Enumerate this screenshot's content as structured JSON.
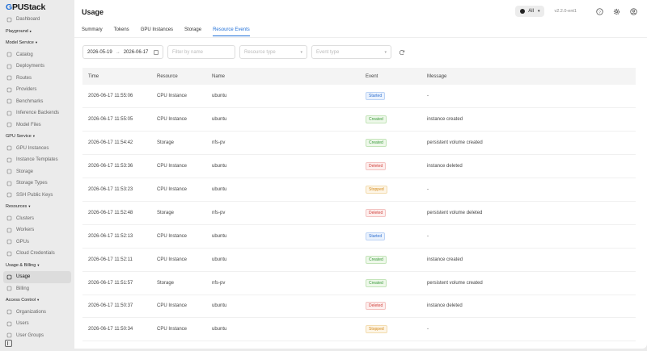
{
  "app": {
    "logo_g": "G",
    "logo_rest": "PUStack"
  },
  "sidebar": {
    "items": [
      {
        "type": "item",
        "label": "Dashboard",
        "icon": "dashboard-icon"
      },
      {
        "type": "section",
        "label": "Playground",
        "caret": "▸"
      },
      {
        "type": "section",
        "label": "Model Service",
        "caret": "▾"
      },
      {
        "type": "item",
        "label": "Catalog",
        "icon": "catalog-icon"
      },
      {
        "type": "item",
        "label": "Deployments",
        "icon": "deployments-icon"
      },
      {
        "type": "item",
        "label": "Routes",
        "icon": "routes-icon"
      },
      {
        "type": "item",
        "label": "Providers",
        "icon": "providers-icon"
      },
      {
        "type": "item",
        "label": "Benchmarks",
        "icon": "benchmarks-icon"
      },
      {
        "type": "item",
        "label": "Inference Backends",
        "icon": "backends-icon"
      },
      {
        "type": "item",
        "label": "Model Files",
        "icon": "files-icon"
      },
      {
        "type": "section",
        "label": "GPU Service",
        "caret": "▾"
      },
      {
        "type": "item",
        "label": "GPU Instances",
        "icon": "gpu-instances-icon"
      },
      {
        "type": "item",
        "label": "Instance Templates",
        "icon": "templates-icon"
      },
      {
        "type": "item",
        "label": "Storage",
        "icon": "storage-icon"
      },
      {
        "type": "item",
        "label": "Storage Types",
        "icon": "storage-types-icon"
      },
      {
        "type": "item",
        "label": "SSH Public Keys",
        "icon": "key-icon"
      },
      {
        "type": "section",
        "label": "Resources",
        "caret": "▾"
      },
      {
        "type": "item",
        "label": "Clusters",
        "icon": "clusters-icon"
      },
      {
        "type": "item",
        "label": "Workers",
        "icon": "workers-icon"
      },
      {
        "type": "item",
        "label": "GPUs",
        "icon": "gpus-icon"
      },
      {
        "type": "item",
        "label": "Cloud Credentials",
        "icon": "cloud-icon"
      },
      {
        "type": "section",
        "label": "Usage & Billing",
        "caret": "▾"
      },
      {
        "type": "item",
        "label": "Usage",
        "icon": "usage-icon",
        "active": true
      },
      {
        "type": "item",
        "label": "Billing",
        "icon": "billing-icon"
      },
      {
        "type": "section",
        "label": "Access Control",
        "caret": "▾"
      },
      {
        "type": "item",
        "label": "Organizations",
        "icon": "organizations-icon"
      },
      {
        "type": "item",
        "label": "Users",
        "icon": "users-icon"
      },
      {
        "type": "item",
        "label": "User Groups",
        "icon": "user-groups-icon"
      }
    ]
  },
  "header": {
    "title": "Usage",
    "scope_select": "All",
    "version": "v2.2.0-ent1"
  },
  "tabs": [
    {
      "label": "Summary",
      "active": false
    },
    {
      "label": "Tokens",
      "active": false
    },
    {
      "label": "GPU Instances",
      "active": false
    },
    {
      "label": "Storage",
      "active": false
    },
    {
      "label": "Resource Events",
      "active": true
    }
  ],
  "filters": {
    "date_start": "2026-05-19",
    "date_end": "2026-06-17",
    "name_placeholder": "Filter by name",
    "resource_type_placeholder": "Resource type",
    "event_type_placeholder": "Event type"
  },
  "table": {
    "columns": [
      "Time",
      "Resource",
      "Name",
      "Event",
      "Message"
    ],
    "rows": [
      {
        "time": "2026-06-17 11:55:06",
        "resource": "CPU Instance",
        "name": "ubuntu",
        "event": "Started",
        "message": "-"
      },
      {
        "time": "2026-06-17 11:55:05",
        "resource": "CPU Instance",
        "name": "ubuntu",
        "event": "Created",
        "message": "instance created"
      },
      {
        "time": "2026-06-17 11:54:42",
        "resource": "Storage",
        "name": "nfs-pv",
        "event": "Created",
        "message": "persistent volume created"
      },
      {
        "time": "2026-06-17 11:53:36",
        "resource": "CPU Instance",
        "name": "ubuntu",
        "event": "Deleted",
        "message": "instance deleted"
      },
      {
        "time": "2026-06-17 11:53:23",
        "resource": "CPU Instance",
        "name": "ubuntu",
        "event": "Stopped",
        "message": "-"
      },
      {
        "time": "2026-06-17 11:52:48",
        "resource": "Storage",
        "name": "nfs-pv",
        "event": "Deleted",
        "message": "persistent volume deleted"
      },
      {
        "time": "2026-06-17 11:52:13",
        "resource": "CPU Instance",
        "name": "ubuntu",
        "event": "Started",
        "message": "-"
      },
      {
        "time": "2026-06-17 11:52:11",
        "resource": "CPU Instance",
        "name": "ubuntu",
        "event": "Created",
        "message": "instance created"
      },
      {
        "time": "2026-06-17 11:51:57",
        "resource": "Storage",
        "name": "nfs-pv",
        "event": "Created",
        "message": "persistent volume created"
      },
      {
        "time": "2026-06-17 11:50:37",
        "resource": "CPU Instance",
        "name": "ubuntu",
        "event": "Deleted",
        "message": "instance deleted"
      },
      {
        "time": "2026-06-17 11:50:34",
        "resource": "CPU Instance",
        "name": "ubuntu",
        "event": "Stopped",
        "message": "-"
      }
    ]
  },
  "colors": {
    "accent": "#1f6fd8",
    "started": "#2f6fd0",
    "created": "#3a9a3a",
    "deleted": "#d2443f",
    "stopped": "#d48a1a"
  }
}
